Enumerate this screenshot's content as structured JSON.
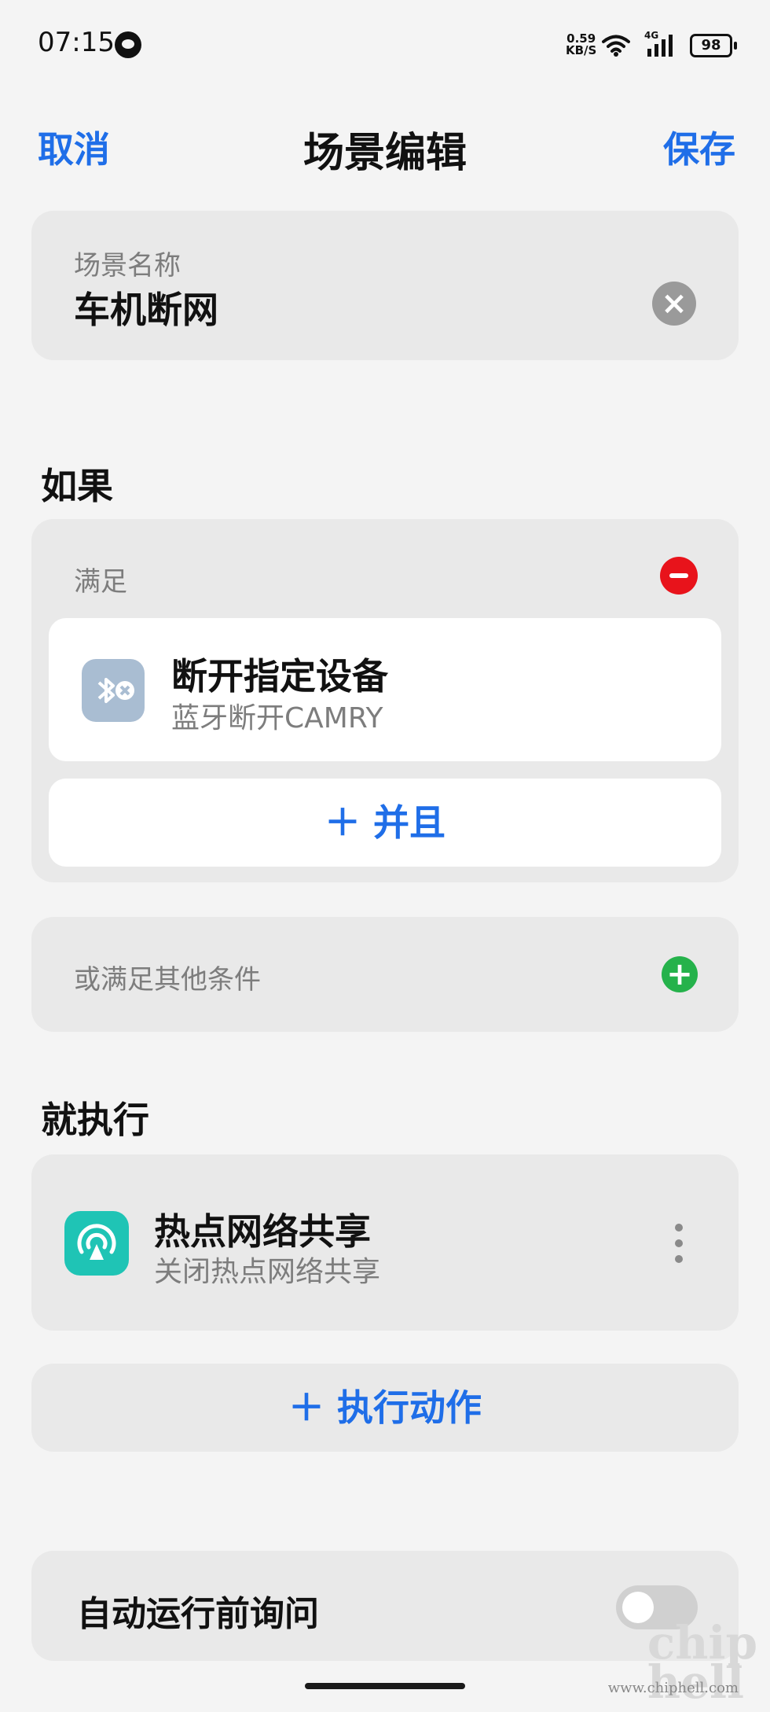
{
  "status_bar": {
    "time": "07:15",
    "net_speed_value": "0.59",
    "net_speed_unit": "KB/S",
    "network_type": "4G",
    "battery": "98"
  },
  "header": {
    "cancel": "取消",
    "title": "场景编辑",
    "save": "保存"
  },
  "scene_name": {
    "label": "场景名称",
    "value": "车机断网"
  },
  "if_section": {
    "title": "如果",
    "meet_label": "满足",
    "condition": {
      "icon": "bluetooth-disconnect-icon",
      "title": "断开指定设备",
      "subtitle": "蓝牙断开CAMRY"
    },
    "and_button": "＋  并且",
    "or_label": "或满足其他条件"
  },
  "then_section": {
    "title": "就执行",
    "action": {
      "icon": "hotspot-icon",
      "title": "热点网络共享",
      "subtitle": "关闭热点网络共享"
    },
    "add_action_button": "＋  执行动作"
  },
  "ask_before_run": {
    "label": "自动运行前询问",
    "enabled": false
  },
  "watermark": {
    "url": "www.chiphell.com"
  },
  "colors": {
    "accent": "#1f6ee8",
    "remove": "#e8131b",
    "add": "#25b24b",
    "hotspot": "#1fc4b5",
    "bluetooth": "#a9bdd2"
  }
}
